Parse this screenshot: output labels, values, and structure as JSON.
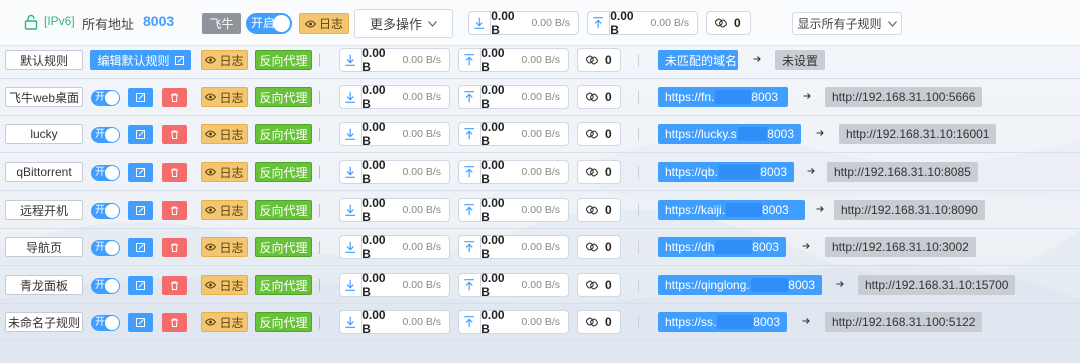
{
  "header": {
    "ipv6_label": "[IPv6]",
    "address_label": "所有地址",
    "port": "8003",
    "device_tag": "飞牛",
    "toggle_label": "开启",
    "log_label": "日志",
    "more_ops": "更多操作",
    "download_amount": "0.00 B",
    "download_rate": "0.00 B/s",
    "upload_amount": "0.00 B",
    "upload_rate": "0.00 B/s",
    "connections": "0",
    "show_all_label": "显示所有子规则"
  },
  "labels": {
    "toggle_on": "开",
    "log": "日志",
    "reverse_proxy": "反向代理",
    "edit_default": "编辑默认规则"
  },
  "rules": [
    {
      "name": "默认规则",
      "is_default": true,
      "dl_amount": "0.00 B",
      "dl_rate": "0.00 B/s",
      "ul_amount": "0.00 B",
      "ul_rate": "0.00 B/s",
      "conns": "0",
      "domain_prefix": "未匹配的域名",
      "domain_suffix": "",
      "target": "未设置"
    },
    {
      "name": "飞牛web桌面",
      "is_default": false,
      "dl_amount": "0.00 B",
      "dl_rate": "0.00 B/s",
      "ul_amount": "0.00 B",
      "ul_rate": "0.00 B/s",
      "conns": "0",
      "domain_prefix": "https://fn.",
      "domain_suffix": "8003",
      "target": "http://192.168.31.100:5666"
    },
    {
      "name": "lucky",
      "is_default": false,
      "dl_amount": "0.00 B",
      "dl_rate": "0.00 B/s",
      "ul_amount": "0.00 B",
      "ul_rate": "0.00 B/s",
      "conns": "0",
      "domain_prefix": "https://lucky.s",
      "domain_suffix": "8003",
      "target": "http://192.168.31.10:16001"
    },
    {
      "name": "qBittorrent",
      "is_default": false,
      "dl_amount": "0.00 B",
      "dl_rate": "0.00 B/s",
      "ul_amount": "0.00 B",
      "ul_rate": "0.00 B/s",
      "conns": "0",
      "domain_prefix": "https://qb.",
      "domain_suffix": "8003",
      "target": "http://192.168.31.10:8085"
    },
    {
      "name": "远程开机",
      "is_default": false,
      "dl_amount": "0.00 B",
      "dl_rate": "0.00 B/s",
      "ul_amount": "0.00 B",
      "ul_rate": "0.00 B/s",
      "conns": "0",
      "domain_prefix": "https://kaiji.",
      "domain_suffix": "8003",
      "target": "http://192.168.31.10:8090"
    },
    {
      "name": "导航页",
      "is_default": false,
      "dl_amount": "0.00 B",
      "dl_rate": "0.00 B/s",
      "ul_amount": "0.00 B",
      "ul_rate": "0.00 B/s",
      "conns": "0",
      "domain_prefix": "https://dh",
      "domain_suffix": "8003",
      "target": "http://192.168.31.10:3002"
    },
    {
      "name": "青龙面板",
      "is_default": false,
      "dl_amount": "0.00 B",
      "dl_rate": "0.00 B/s",
      "ul_amount": "0.00 B",
      "ul_rate": "0.00 B/s",
      "conns": "0",
      "domain_prefix": "https://qinglong.",
      "domain_suffix": "8003",
      "target": "http://192.168.31.10:15700"
    },
    {
      "name": "未命名子规则",
      "is_default": false,
      "dl_amount": "0.00 B",
      "dl_rate": "0.00 B/s",
      "ul_amount": "0.00 B",
      "ul_rate": "0.00 B/s",
      "conns": "0",
      "domain_prefix": "https://ss.",
      "domain_suffix": "8003",
      "target": "http://192.168.31.100:5122"
    }
  ],
  "colors": {
    "accent": "#409eff",
    "success": "#67c23a",
    "danger": "#f56c6c",
    "warning": "#f3c66f",
    "info": "#909399"
  },
  "icons": {
    "lock": "lock-icon",
    "download": "download-arrow-icon",
    "upload": "upload-arrow-icon",
    "link": "link-icon",
    "edit": "edit-icon",
    "delete": "trash-icon",
    "eye": "eye-icon",
    "chevron": "chevron-down-icon",
    "arrow": "arrow-right-icon"
  }
}
